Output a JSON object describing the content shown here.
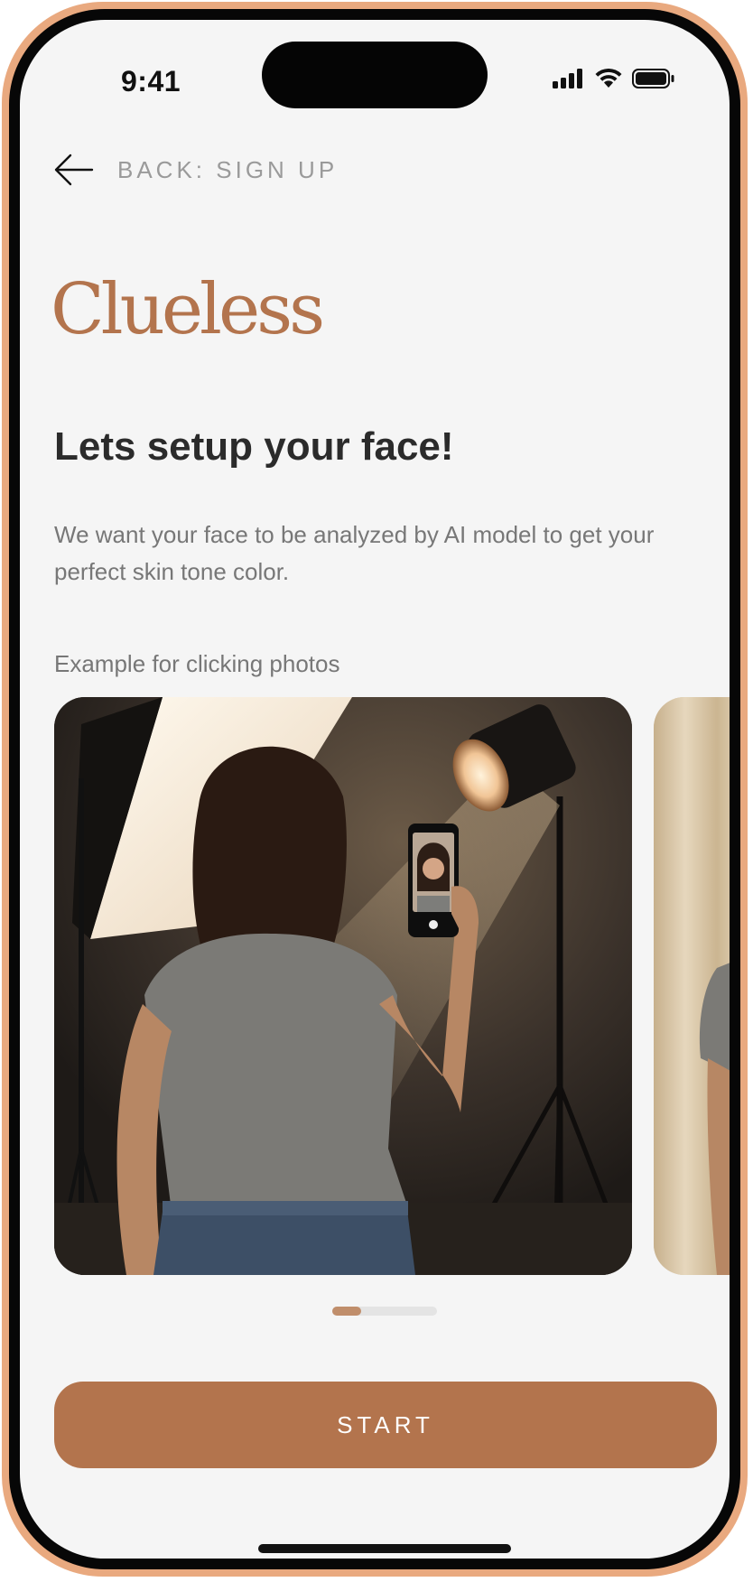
{
  "status_bar": {
    "time": "9:41",
    "icons": [
      "cellular-signal-icon",
      "wifi-icon",
      "battery-icon"
    ]
  },
  "nav": {
    "back_label": "BACK: SIGN UP",
    "back_icon": "arrow-left-icon"
  },
  "brand": {
    "logo_text": "Clueless",
    "accent_color": "#b3744d"
  },
  "main": {
    "heading": "Lets setup your face!",
    "description": "We want your face to be analyzed by AI model to get your perfect skin tone color.",
    "example_label": "Example for clicking photos"
  },
  "carousel": {
    "slide_count": 2,
    "active_index": 0,
    "items": [
      "woman-taking-selfie-studio-image",
      "woman-by-curtain-image"
    ]
  },
  "actions": {
    "start_label": "START"
  },
  "colors": {
    "screen_background": "#f5f5f5",
    "frame": "#e9a97f",
    "heading": "#2b2b2b",
    "muted_text": "#777777"
  }
}
